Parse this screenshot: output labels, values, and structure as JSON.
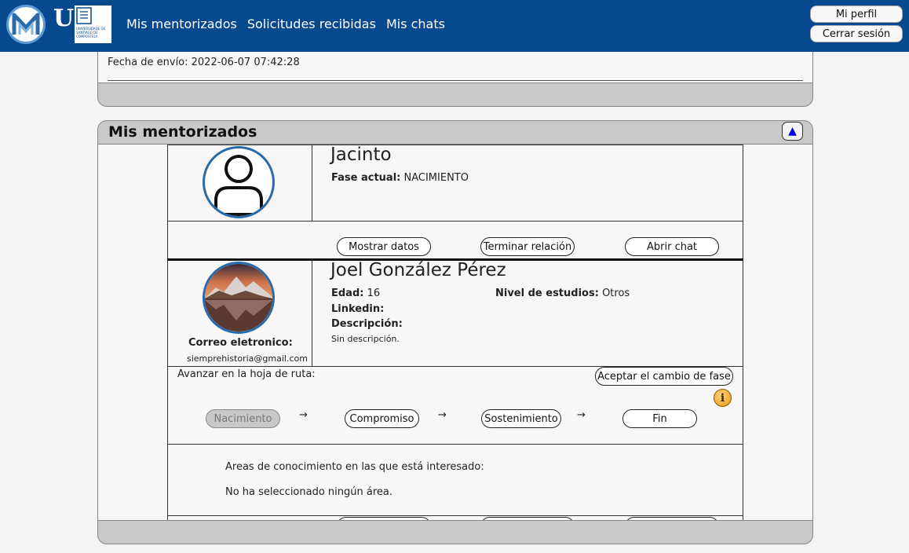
{
  "header": {
    "logo_m": "M",
    "logo_usc": "USC",
    "logo_usc_subtitle": "UNIVERSIDADE DE SANTIAGO DE COMPOSTELA",
    "nav": [
      "Mis mentorizados",
      "Solicitudes recibidas",
      "Mis chats"
    ],
    "profile_button": "Mi perfil",
    "logout_button": "Cerrar sesión",
    "bar_color": "#07498f"
  },
  "requests_panel": {
    "fecha_envio": "Fecha de envío: 2022-06-07 07:42:28"
  },
  "mentees_panel": {
    "title": "Mis mentorizados",
    "collapse_icon": "▲",
    "mentees": [
      {
        "name": "Jacinto",
        "avatar_icon": "default-user-icon",
        "fase_label": "Fase actual:",
        "fase_value": "NACIMIENTO",
        "buttons": [
          "Mostrar datos",
          "Terminar relación",
          "Abrir chat"
        ]
      },
      {
        "name": "Joel González Pérez",
        "avatar_icon": "mountain-photo",
        "edad_label": "Edad:",
        "edad_value": "16",
        "nivel_label": "Nivel de estudios:",
        "nivel_value": "Otros",
        "linkedin_label": "Linkedin:",
        "descripcion_label": "Descripción:",
        "descripcion_value": "Sin descripción.",
        "correo_label": "Correo eletronico:",
        "correo_value": "siemprehistoria@gmail.com",
        "ruta_label": "Avanzar en la hoja de ruta:",
        "aceptar_button": "Aceptar el cambio de fase",
        "fases": [
          "Nacimiento",
          "Compromiso",
          "Sostenimiento",
          "Fin"
        ],
        "arrow": "→",
        "areas_title": "Areas de conocimiento en las que está interesado:",
        "areas_value": "No ha seleccionado ningún área."
      }
    ]
  }
}
